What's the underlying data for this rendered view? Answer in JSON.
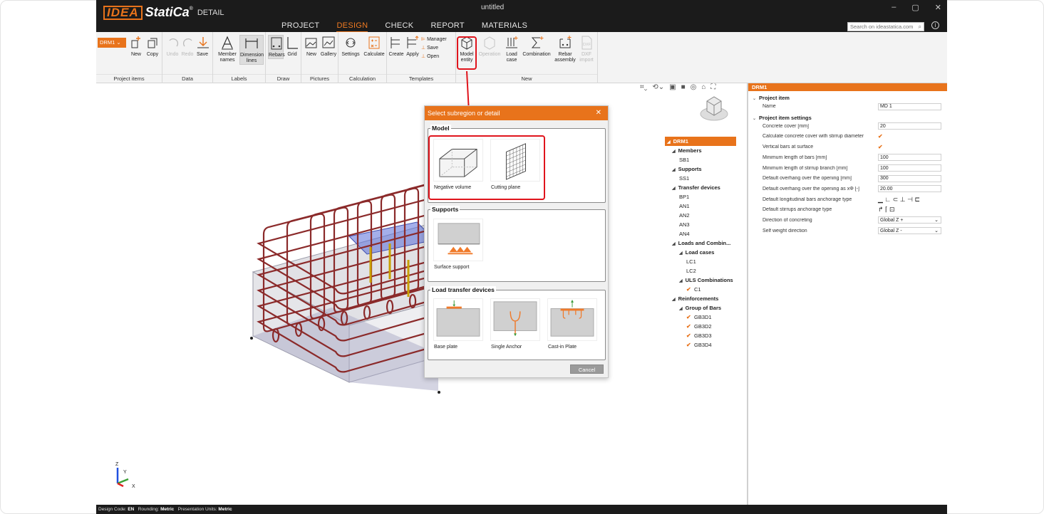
{
  "window": {
    "title": "untitled",
    "logo_idea": "IDEA",
    "logo_statica": "StatiCa",
    "logo_reg": "®",
    "logo_detail": "DETAIL",
    "controls": [
      "–",
      "▢",
      "✕"
    ]
  },
  "menu": [
    "PROJECT",
    "DESIGN",
    "CHECK",
    "REPORT",
    "MATERIALS"
  ],
  "active_menu": "DESIGN",
  "search": {
    "placeholder": "Search on ideastatica.com"
  },
  "ribbon": {
    "project_select": "DRM1",
    "project_items": {
      "label": "Project items",
      "new": "New",
      "copy": "Copy"
    },
    "data": {
      "label": "Data",
      "undo": "Undo",
      "redo": "Redo",
      "save": "Save"
    },
    "labels": {
      "label": "Labels",
      "member_names": [
        "Member",
        "names"
      ],
      "dimension_lines": [
        "Dimension",
        "lines"
      ]
    },
    "draw": {
      "label": "Draw",
      "rebars": "Rebars",
      "grid": "Grid"
    },
    "pictures": {
      "label": "Pictures",
      "new": "New",
      "gallery": "Gallery"
    },
    "calculation": {
      "label": "Calculation",
      "settings": "Settings",
      "calculate": "Calculate"
    },
    "templates": {
      "label": "Templates",
      "create": "Create",
      "apply": "Apply",
      "manager": "Manager",
      "save": "Save",
      "open": "Open"
    },
    "new_group": {
      "label": "New",
      "model_entity": [
        "Model",
        "entity"
      ],
      "operation": "Operation",
      "load_case": [
        "Load",
        "case"
      ],
      "combination": "Combination",
      "rebar_assembly": [
        "Rebar",
        "assembly"
      ],
      "dxf_import": [
        "DXF",
        "import"
      ],
      "dxf_icon": "DXF"
    }
  },
  "dialog": {
    "title": "Select subregion or detail",
    "close": "✕",
    "model": {
      "label": "Model",
      "items": [
        "Negative volume",
        "Cutting plane"
      ]
    },
    "supports": {
      "label": "Supports",
      "items": [
        "Surface support"
      ]
    },
    "load_transfer": {
      "label": "Load transfer devices",
      "items": [
        "Base plate",
        "Single Anchor",
        "Cast-in Plate"
      ]
    },
    "cancel": "Cancel"
  },
  "tree": [
    {
      "label": "DRM1",
      "level": 0,
      "selected": true
    },
    {
      "label": "Members",
      "level": 1,
      "bold": true
    },
    {
      "label": "SB1",
      "level": 2
    },
    {
      "label": "Supports",
      "level": 1,
      "bold": true
    },
    {
      "label": "SS1",
      "level": 2
    },
    {
      "label": "Transfer devices",
      "level": 1,
      "bold": true
    },
    {
      "label": "BP1",
      "level": 2
    },
    {
      "label": "AN1",
      "level": 2
    },
    {
      "label": "AN2",
      "level": 2
    },
    {
      "label": "AN3",
      "level": 2
    },
    {
      "label": "AN4",
      "level": 2
    },
    {
      "label": "Loads and Combin...",
      "level": 1,
      "bold": true
    },
    {
      "label": "Load cases",
      "level": 2,
      "bold": true
    },
    {
      "label": "LC1",
      "level": 3
    },
    {
      "label": "LC2",
      "level": 3
    },
    {
      "label": "ULS Combinations",
      "level": 2,
      "bold": true
    },
    {
      "label": "C1",
      "level": 3,
      "check": true
    },
    {
      "label": "Reinforcements",
      "level": 1,
      "bold": true
    },
    {
      "label": "Group of Bars",
      "level": 2,
      "bold": true
    },
    {
      "label": "GB3D1",
      "level": 3,
      "check": true
    },
    {
      "label": "GB3D2",
      "level": 3,
      "check": true
    },
    {
      "label": "GB3D3",
      "level": 3,
      "check": true
    },
    {
      "label": "GB3D4",
      "level": 3,
      "check": true
    }
  ],
  "properties": {
    "header": "DRM1",
    "project_item": {
      "title": "Project item",
      "name_label": "Name",
      "name_value": "MD 1"
    },
    "settings": {
      "title": "Project item settings",
      "rows": [
        {
          "label": "Concrete cover [mm]",
          "value": "20",
          "kind": "text"
        },
        {
          "label": "Calculate concrete cover with stirrup diameter",
          "value": "✔",
          "kind": "check"
        },
        {
          "label": "Vertical bars at surface",
          "value": "✔",
          "kind": "check"
        },
        {
          "label": "Minimum length of bars [mm]",
          "value": "100",
          "kind": "text"
        },
        {
          "label": "Minimum length of stirrup branch [mm]",
          "value": "100",
          "kind": "text"
        },
        {
          "label": "Default overhang over the opening [mm]",
          "value": "300",
          "kind": "text"
        },
        {
          "label": "Default overhang over the opening as xΦ [-]",
          "value": "20.00",
          "kind": "text"
        },
        {
          "label": "Default longitudinal bars anchorage type",
          "value": "▁ ∟ ⊂ ⊥ ⊣ ⊏",
          "kind": "icons"
        },
        {
          "label": "Default stirrups anchorage type",
          "value": "↱ ⌈ ⊡",
          "kind": "icons"
        },
        {
          "label": "Direction of concreting",
          "value": "Global Z +",
          "kind": "select"
        },
        {
          "label": "Self weight direction",
          "value": "Global Z -",
          "kind": "select"
        }
      ]
    }
  },
  "axes": {
    "z": "Z",
    "y": "Y",
    "x": "X"
  },
  "statusbar": {
    "design_code_label": "Design Code: ",
    "design_code": "EN",
    "rounding_label": "Rounding: ",
    "rounding": "Metric",
    "units_label": "Presentation Units: ",
    "units": "Metric"
  },
  "colors": {
    "accent": "#e8731b",
    "highlight": "#e0141c",
    "rebar": "#8b2a2a",
    "titlebar": "#1b1b1b"
  }
}
